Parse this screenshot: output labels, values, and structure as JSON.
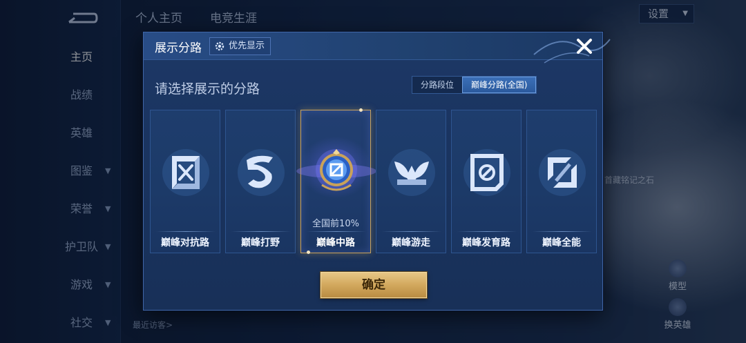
{
  "colors": {
    "modal_bg": "#1b3562",
    "accent_blue": "#3b6fb8",
    "gold": "#d2a85d",
    "selected_border": "#c9a25a"
  },
  "background": {
    "top_tabs": [
      "个人主页",
      "电竞生涯"
    ],
    "settings_label": "设置",
    "nav_items": [
      {
        "label": "主页",
        "active": true,
        "chevron": false
      },
      {
        "label": "战绩",
        "active": false,
        "chevron": false
      },
      {
        "label": "英雄",
        "active": false,
        "chevron": false
      },
      {
        "label": "图鉴",
        "active": false,
        "chevron": true
      },
      {
        "label": "荣誉",
        "active": false,
        "chevron": true
      },
      {
        "label": "护卫队",
        "active": false,
        "chevron": true
      },
      {
        "label": "游戏",
        "active": false,
        "chevron": true
      },
      {
        "label": "社交",
        "active": false,
        "chevron": true
      }
    ],
    "recent_visitors_label": "最近访客>",
    "model_button_label": "模型",
    "switch_hero_label": "换英雄",
    "hero_item_label": "首藏铭记之石"
  },
  "modal": {
    "title": "展示分路",
    "priority_button_label": "优先显示",
    "prompt": "请选择展示的分路",
    "segments": [
      {
        "label": "分路段位",
        "active": false
      },
      {
        "label": "巅峰分路(全国)",
        "active": true
      }
    ],
    "lanes": [
      {
        "label": "巅峰对抗路",
        "icon": "clash-lane-icon",
        "selected": false,
        "sub": ""
      },
      {
        "label": "巅峰打野",
        "icon": "jungle-icon",
        "selected": false,
        "sub": ""
      },
      {
        "label": "巅峰中路",
        "icon": "mid-lane-icon",
        "selected": true,
        "sub": "全国前10%"
      },
      {
        "label": "巅峰游走",
        "icon": "roam-icon",
        "selected": false,
        "sub": ""
      },
      {
        "label": "巅峰发育路",
        "icon": "farm-lane-icon",
        "selected": false,
        "sub": ""
      },
      {
        "label": "巅峰全能",
        "icon": "all-round-icon",
        "selected": false,
        "sub": ""
      }
    ],
    "confirm_label": "确定"
  }
}
